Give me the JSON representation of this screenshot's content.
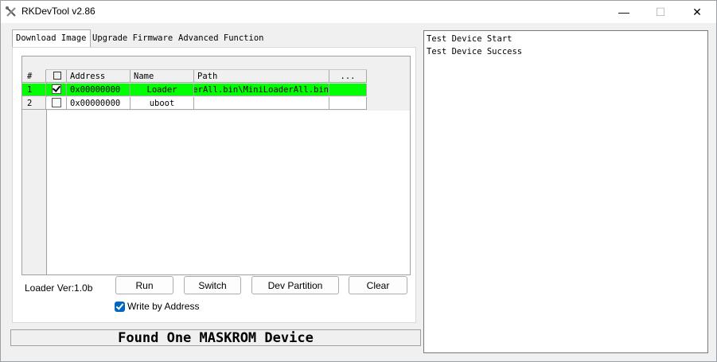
{
  "window": {
    "title": "RKDevTool v2.86",
    "minimize_glyph": "—",
    "maximize_glyph": "☐",
    "close_glyph": "✕"
  },
  "tabs": [
    {
      "label": "Download Image",
      "active": true
    },
    {
      "label": "Upgrade Firmware",
      "active": false
    },
    {
      "label": "Advanced Function",
      "active": false
    }
  ],
  "grid": {
    "headers": [
      "#",
      "",
      "Address",
      "Name",
      "Path",
      "..."
    ],
    "rows": [
      {
        "num": "1",
        "checked": true,
        "address": "0x00000000",
        "name": "Loader",
        "path": "derAll.bin\\MiniLoaderAll.bin",
        "highlight_color": "#00ff00"
      },
      {
        "num": "2",
        "checked": false,
        "address": "0x00000000",
        "name": "uboot",
        "path": ""
      }
    ]
  },
  "loader_version": "Loader Ver:1.0b",
  "buttons": {
    "run": "Run",
    "switch": "Switch",
    "dev_partition": "Dev Partition",
    "clear": "Clear"
  },
  "write_by_address": {
    "label": "Write by Address",
    "checked": true
  },
  "status": "Found One MASKROM Device",
  "log": [
    "Test Device Start",
    "Test Device Success"
  ]
}
